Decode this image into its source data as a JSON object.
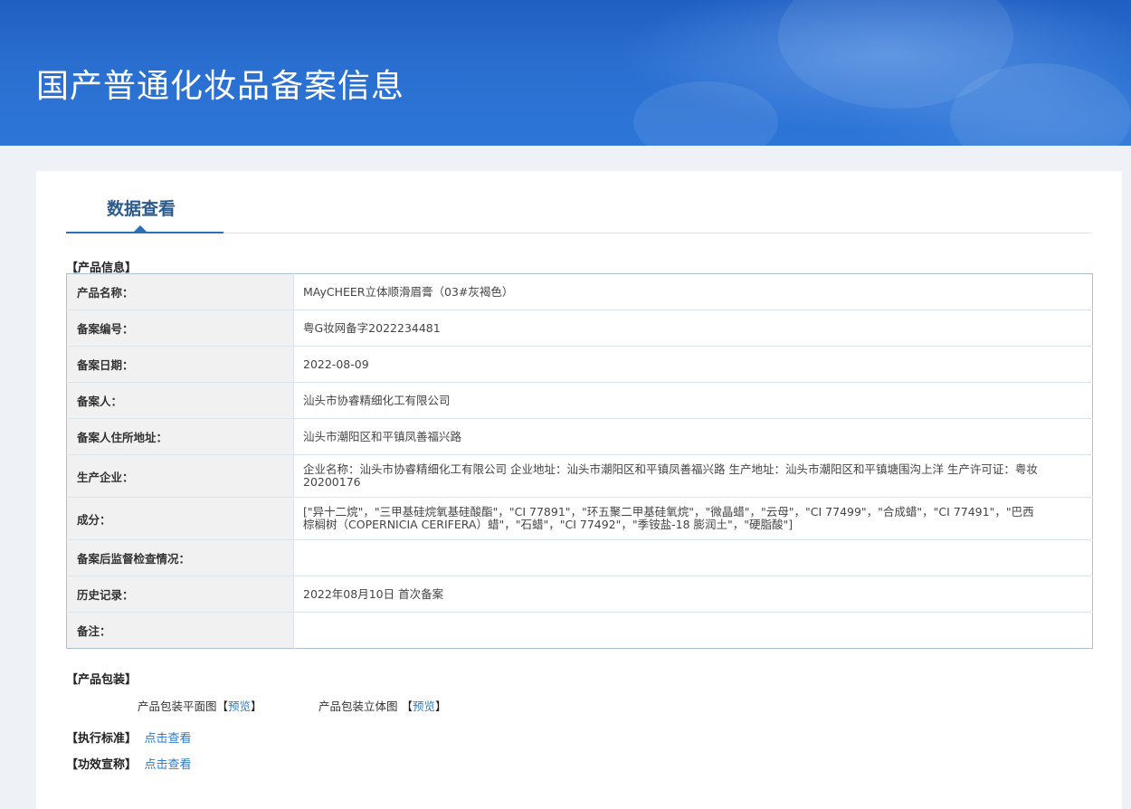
{
  "banner": {
    "title": "国产普通化妆品备案信息"
  },
  "tab": {
    "label": "数据查看"
  },
  "product_info": {
    "section_title": "【产品信息】",
    "rows": [
      {
        "label": "产品名称：",
        "value": "MAyCHEER立体顺滑眉膏（03#灰褐色）"
      },
      {
        "label": "备案编号：",
        "value": "粤G妆网备字2022234481"
      },
      {
        "label": "备案日期：",
        "value": "2022-08-09"
      },
      {
        "label": "备案人：",
        "value": "汕头市协睿精细化工有限公司"
      },
      {
        "label": "备案人住所地址：",
        "value": "汕头市潮阳区和平镇凤善福兴路"
      },
      {
        "label": "生产企业：",
        "value": "企业名称：汕头市协睿精细化工有限公司 企业地址：汕头市潮阳区和平镇凤善福兴路 生产地址：汕头市潮阳区和平镇塘围沟上洋 生产许可证：粤妆20200176"
      },
      {
        "label": "成分：",
        "value": "[\"异十二烷\"，\"三甲基硅烷氧基硅酸酯\"，\"CI 77891\"，\"环五聚二甲基硅氧烷\"，\"微晶蜡\"，\"云母\"，\"CI 77499\"，\"合成蜡\"，\"CI 77491\"，\"巴西棕榈树（COPERNICIA CERIFERA）蜡\"，\"石蜡\"，\"CI 77492\"，\"季铵盐-18 膨润土\"，\"硬脂酸\"]"
      },
      {
        "label": "备案后监督检查情况：",
        "value": ""
      },
      {
        "label": "历史记录：",
        "value": "2022年08月10日 首次备案"
      },
      {
        "label": "备注：",
        "value": ""
      }
    ]
  },
  "packaging": {
    "section_title": "【产品包装】",
    "flat_label": "产品包装平面图",
    "flat_link": "预览",
    "solid_label": "产品包装立体图",
    "solid_link": "预览"
  },
  "standard": {
    "section_title": "【执行标准】",
    "link": "点击查看"
  },
  "efficacy": {
    "section_title": "【功效宣称】",
    "link": "点击查看"
  },
  "colors": {
    "banner": "#2a6fd0",
    "tab": "#2b5a8c",
    "link": "#2b7bc9",
    "table_border": "#a9c0d6"
  }
}
